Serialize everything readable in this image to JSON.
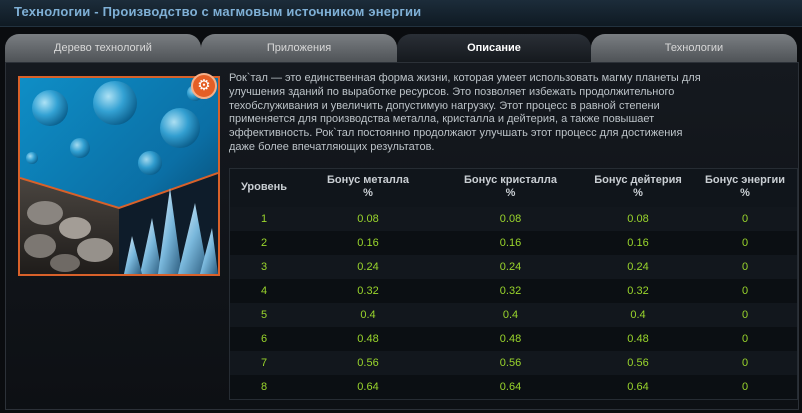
{
  "window": {
    "title": "Технологии - Производство с магмовым источником энергии"
  },
  "tabs": [
    {
      "label": "Дерево технологий",
      "active": false
    },
    {
      "label": "Приложения",
      "active": false
    },
    {
      "label": "Описание",
      "active": true
    },
    {
      "label": "Технологии",
      "active": false
    }
  ],
  "description": "Рок`тал — это единственная форма жизни, которая умеет использовать магму планеты для\nулучшения зданий по выработке ресурсов. Это позволяет избежать продолжительного\nтехобслуживания и увеличить допустимую нагрузку. Этот процесс в равной степени\nприменяется для производства металла, кристалла и дейтерия, а также повышает\nэффективность. Рок`тал постоянно продолжают улучшать этот процесс для достижения\nдаже более впечатляющих результатов.",
  "table": {
    "headers": [
      "Уровень",
      "Бонус металла\n%",
      "Бонус кристалла\n%",
      "Бонус дейтерия\n%",
      "Бонус энергии\n%"
    ],
    "rows": [
      [
        "1",
        "0.08",
        "0.08",
        "0.08",
        "0"
      ],
      [
        "2",
        "0.16",
        "0.16",
        "0.16",
        "0"
      ],
      [
        "3",
        "0.24",
        "0.24",
        "0.24",
        "0"
      ],
      [
        "4",
        "0.32",
        "0.32",
        "0.32",
        "0"
      ],
      [
        "5",
        "0.4",
        "0.4",
        "0.4",
        "0"
      ],
      [
        "6",
        "0.48",
        "0.48",
        "0.48",
        "0"
      ],
      [
        "7",
        "0.56",
        "0.56",
        "0.56",
        "0"
      ],
      [
        "8",
        "0.64",
        "0.64",
        "0.64",
        "0"
      ]
    ]
  },
  "icons": {
    "settings": "gear-icon"
  },
  "colors": {
    "accent": "#e45f26",
    "value_green": "#9ad62c",
    "title_blue": "#7fb0d6"
  }
}
